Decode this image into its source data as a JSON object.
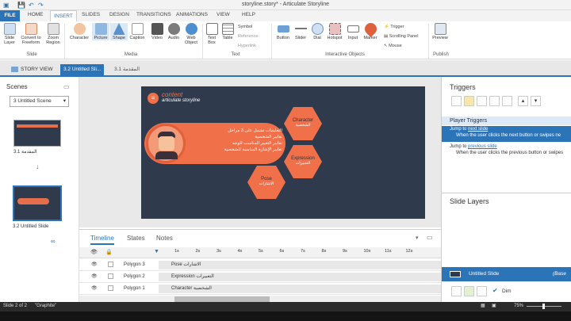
{
  "window": {
    "title": "storyline.story* - Articulate Storyline"
  },
  "tabs": {
    "file": "FILE",
    "home": "HOME",
    "insert": "INSERT",
    "slides": "SLIDES",
    "design": "DESIGN",
    "transitions": "TRANSITIONS",
    "animations": "ANIMATIONS",
    "view": "VIEW",
    "help": "HELP"
  },
  "ribbon": {
    "slide_layer": "Slide Layer",
    "convert": "Convert to Freeform",
    "zoom": "Zoom Region",
    "group_slide": "Slide",
    "character": "Character",
    "picture": "Picture",
    "shape": "Shape",
    "caption": "Caption",
    "video": "Video",
    "audio": "Audio",
    "web_object": "Web Object",
    "group_media": "Media",
    "text_box": "Text Box",
    "table": "Table",
    "symbol": "Symbol",
    "reference": "Reference",
    "hyperlink": "Hyperlink",
    "group_text": "Text",
    "button": "Button",
    "slider": "Slider",
    "dial": "Dial",
    "hotspot": "Hotspot",
    "input": "Input",
    "marker": "Marker",
    "trigger": "Trigger",
    "scrolling_panel": "Scrolling Panel",
    "mouse": "Mouse",
    "group_interactive": "Interactive Objects",
    "preview": "Preview",
    "group_publish": "Publish"
  },
  "doc_tabs": {
    "story_view": "STORY VIEW",
    "active": "3.2 Untitled Sli...",
    "other": "3.1 المقدمة"
  },
  "scenes": {
    "title": "Scenes",
    "dropdown": "3 Untitled Scene",
    "thumb1": "3.1 المقدمة",
    "thumb2": "3.2 Untitled Slide"
  },
  "slide": {
    "brand_title": "content",
    "brand_sub": "articulate storyline",
    "bullets": [
      "التعليمات تشمل على 3 مراحل",
      "تعابير الشخصية",
      "تعابير التعبير المناسب للوجه",
      "تعابير الإشارة المناسبة للشخصية"
    ],
    "hex1": "Character",
    "hex1_ar": "الشخصية",
    "hex2": "Expression",
    "hex2_ar": "التعبيرات",
    "hex3": "Pose",
    "hex3_ar": "الاشارات"
  },
  "timeline": {
    "tab_timeline": "Timeline",
    "tab_states": "States",
    "tab_notes": "Notes",
    "ticks": [
      "1s",
      "2s",
      "3s",
      "4s",
      "5s",
      "6s",
      "7s",
      "8s",
      "9s",
      "10s",
      "11s",
      "12s"
    ],
    "rows": [
      {
        "name": "Polygon 3",
        "label": "Pose الاشارات"
      },
      {
        "name": "Polygon 2",
        "label": "Expression التعبيرات"
      },
      {
        "name": "Polygon 1",
        "label": "Character الشخصية"
      }
    ]
  },
  "triggers": {
    "title": "Triggers",
    "player_triggers": "Player Triggers",
    "t1_prefix": "Jump to",
    "t1_link": "next slide",
    "t1_desc": "When the user clicks the next button or swipes ne",
    "t2_prefix": "Jump to",
    "t2_link": "previous slide",
    "t2_desc": "When the user clicks the previous button or swipes"
  },
  "layers": {
    "title": "Slide Layers",
    "base": "Untitled Slide",
    "base_tag": "(Base La",
    "dim": "Dim"
  },
  "status": {
    "slide": "Slide 2 of 2",
    "theme": "\"Graphite\"",
    "zoom": "75%"
  },
  "colors": {
    "accent": "#2b74b8",
    "hex": "#f0704a",
    "slide_bg": "#2f3a4d"
  }
}
